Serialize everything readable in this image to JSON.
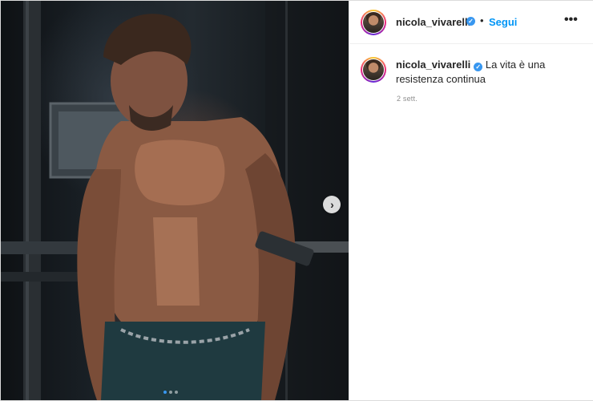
{
  "post": {
    "author": "nicola_vivarelli",
    "follow_label": "Segui",
    "separator": "•",
    "more_label": "•••",
    "caption": "La vita è una resistenza continua",
    "timestamp": "2 sett."
  },
  "carousel": {
    "next_label": "›",
    "slide_count": 3,
    "current_slide": 1
  },
  "icons": {
    "verified": "verified-badge-icon",
    "next": "chevron-right-icon",
    "more": "more-options-icon"
  },
  "colors": {
    "accent": "#0095f6",
    "verified": "#3897f0",
    "text": "#262626",
    "muted": "#8e8e8e"
  }
}
